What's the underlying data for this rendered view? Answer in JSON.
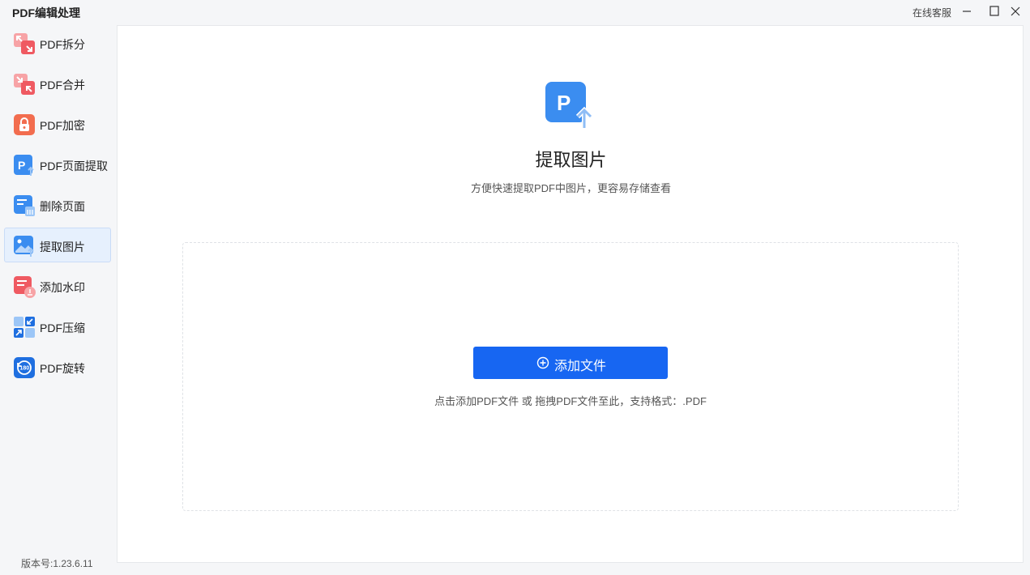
{
  "app": {
    "title": "PDF编辑处理",
    "service_link": "在线客服",
    "version": "版本号:1.23.6.11"
  },
  "window_controls": [
    "minimize",
    "maximize",
    "close"
  ],
  "sidebar": {
    "items": [
      {
        "label": "PDF拆分",
        "icon": "split-icon",
        "color": "#f0656b",
        "active": false
      },
      {
        "label": "PDF合并",
        "icon": "merge-icon",
        "color": "#f0656b",
        "active": false
      },
      {
        "label": "PDF加密",
        "icon": "lock-icon",
        "color": "#f26d4f",
        "active": false
      },
      {
        "label": "PDF页面提取",
        "icon": "page-extract-icon",
        "color": "#3b8df0",
        "active": false
      },
      {
        "label": "删除页面",
        "icon": "delete-page-icon",
        "color": "#3b8df0",
        "active": false
      },
      {
        "label": "提取图片",
        "icon": "image-extract-icon",
        "color": "#3b8df0",
        "active": true
      },
      {
        "label": "添加水印",
        "icon": "watermark-icon",
        "color": "#f0656b",
        "active": false
      },
      {
        "label": "PDF压缩",
        "icon": "compress-icon",
        "color": "#1f6fe0",
        "active": false
      },
      {
        "label": "PDF旋转",
        "icon": "rotate-icon",
        "color": "#1f6fe0",
        "active": false
      }
    ]
  },
  "main": {
    "hero_icon": "pdf-upload-icon",
    "title": "提取图片",
    "subtitle": "方便快速提取PDF中图片，更容易存储查看",
    "add_button_label": "添加文件",
    "drop_hint": "点击添加PDF文件 或 拖拽PDF文件至此，支持格式：.PDF"
  },
  "colors": {
    "accent": "#1766f2",
    "active_bg": "#e6f0fd",
    "page_bg": "#f5f6f8"
  }
}
